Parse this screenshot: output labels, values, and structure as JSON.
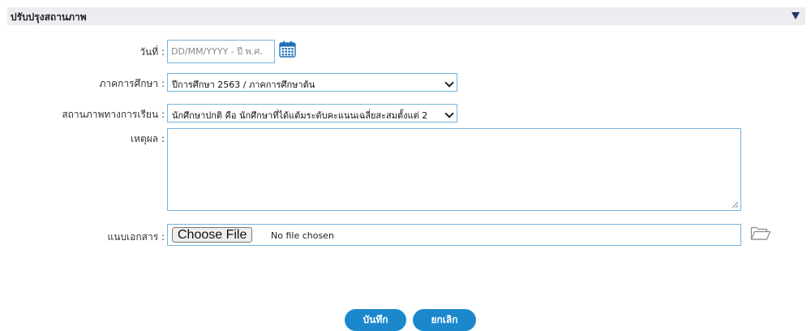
{
  "section": {
    "title": "ปรับปรุงสถานภาพ"
  },
  "form": {
    "date": {
      "label": "วันที่ :",
      "placeholder": "DD/MM/YYYY - ปี พ.ศ.",
      "value": ""
    },
    "semester": {
      "label": "ภาคการศึกษา :",
      "selected": "ปีการศึกษา 2563 / ภาคการศึกษาต้น"
    },
    "study_status": {
      "label": "สถานภาพทางการเรียน :",
      "selected": "นักศึกษาปกติ คือ นักศึกษาที่ได้แต้มระดับคะแนนเฉลี่ยสะสมตั้งแต่ 2"
    },
    "reason": {
      "label": "เหตุผล :",
      "value": ""
    },
    "attachment": {
      "label": "แนบเอกสาร :",
      "button_label": "Choose File",
      "status": "No file chosen"
    }
  },
  "actions": {
    "save_label": "บันทึก",
    "cancel_label": "ยกเลิก"
  },
  "icons": {
    "collapse": "triangle-down-icon",
    "calendar": "calendar-icon",
    "folder": "folder-open-icon"
  },
  "colors": {
    "accent": "#1b88cc",
    "input_border": "#78b4dd",
    "header_bg": "#ededf1",
    "header_arrow": "#1b3a66"
  }
}
